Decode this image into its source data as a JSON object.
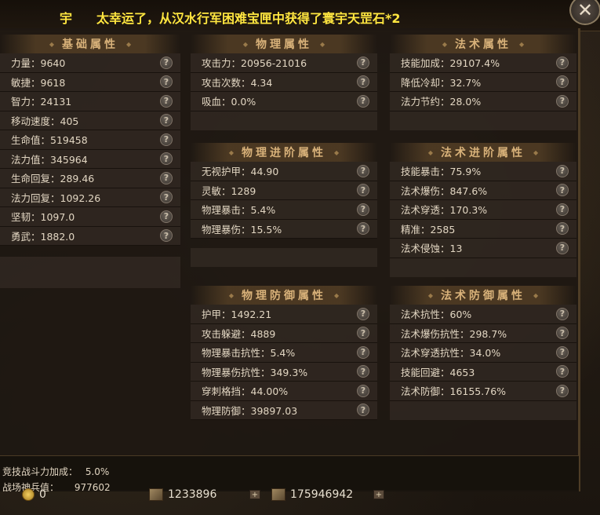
{
  "banner": {
    "sender": "宇",
    "message": "太幸运了，从汉水行军困难宝匣中获得了寰宇天罡石*2"
  },
  "close_label": "✕",
  "help_glyph": "?",
  "sections": {
    "basic": {
      "title": "基础属性",
      "rows": [
        "力量：9640",
        "敏捷：9618",
        "智力：24131",
        "移动速度：405",
        "生命值：519458",
        "法力值：345964",
        "生命回复：289.46",
        "法力回复：1092.26",
        "坚韧：1097.0",
        "勇武：1882.0"
      ]
    },
    "physical": {
      "title": "物理属性",
      "rows": [
        "攻击力：20956-21016",
        "攻击次数：4.34",
        "吸血：0.0%"
      ]
    },
    "magic": {
      "title": "法术属性",
      "rows": [
        "技能加成：29107.4%",
        "降低冷却：32.7%",
        "法力节约：28.0%"
      ]
    },
    "physical_adv": {
      "title": "物理进阶属性",
      "rows": [
        "无视护甲：44.90",
        "灵敏：1289",
        "物理暴击：5.4%",
        "物理暴伤：15.5%"
      ]
    },
    "magic_adv": {
      "title": "法术进阶属性",
      "rows": [
        "技能暴击：75.9%",
        "法术爆伤：847.6%",
        "法术穿透：170.3%",
        "精准：2585",
        "法术侵蚀：13"
      ]
    },
    "physical_def": {
      "title": "物理防御属性",
      "rows": [
        "护甲：1492.21",
        "攻击躲避：4889",
        "物理暴击抗性：5.4%",
        "物理暴伤抗性：349.3%",
        "穿刺格挡：44.00%",
        "物理防御：39897.03"
      ]
    },
    "magic_def": {
      "title": "法术防御属性",
      "rows": [
        "法术抗性：60%",
        "法术爆伤抗性：298.7%",
        "法术穿透抗性：34.0%",
        "技能回避：4653",
        "法术防御：16155.76%"
      ]
    }
  },
  "bottom": {
    "arena_label": "竞技战斗力加成：",
    "arena_value": "5.0%",
    "battle_label": "战场神兵值：",
    "battle_value": "977602"
  },
  "resources": {
    "gold": "0",
    "res2": "1233896",
    "res3": "175946942"
  }
}
